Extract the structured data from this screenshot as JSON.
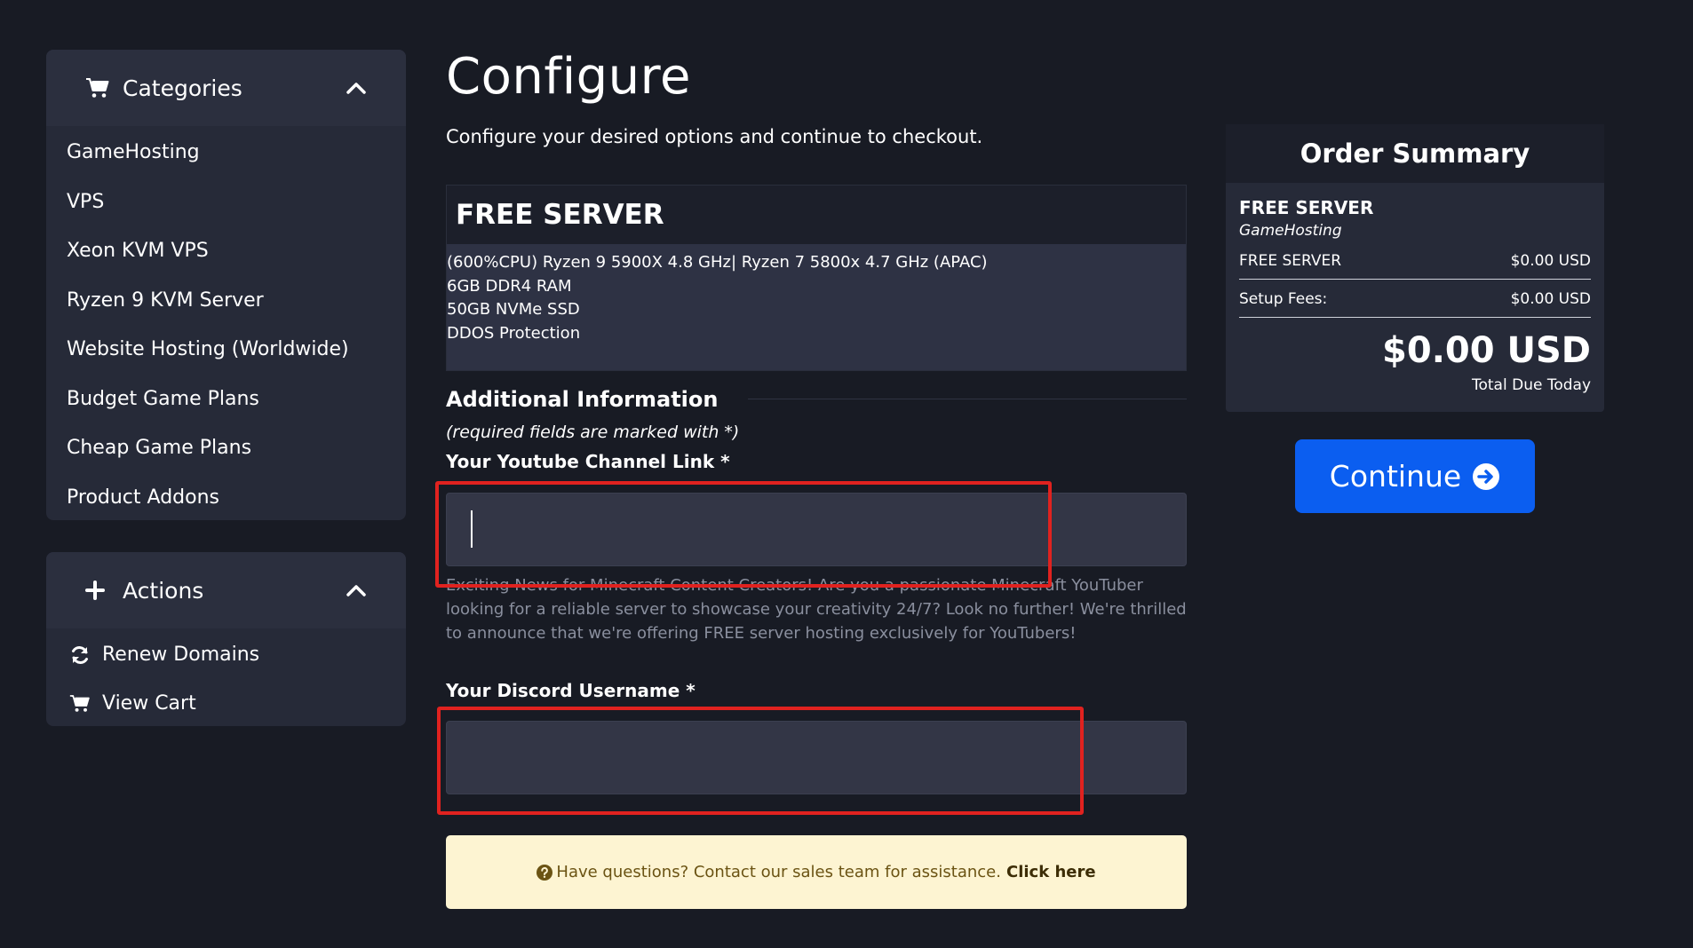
{
  "sidebar": {
    "categories": {
      "title": "Categories",
      "items": [
        {
          "label": "GameHosting"
        },
        {
          "label": "VPS"
        },
        {
          "label": "Xeon KVM VPS"
        },
        {
          "label": "Ryzen 9 KVM Server"
        },
        {
          "label": "Website Hosting (Worldwide)"
        },
        {
          "label": "Budget Game Plans"
        },
        {
          "label": "Cheap Game Plans"
        },
        {
          "label": "Product Addons"
        }
      ]
    },
    "actions": {
      "title": "Actions",
      "items": [
        {
          "label": "Renew Domains",
          "icon": "refresh-icon"
        },
        {
          "label": "View Cart",
          "icon": "cart-icon"
        }
      ]
    }
  },
  "main": {
    "title": "Configure",
    "subtitle": "Configure your desired options and continue to checkout.",
    "product": {
      "name": "FREE SERVER",
      "features": [
        "(600%CPU) Ryzen 9 5900X 4.8 GHz| Ryzen 7 5800x 4.7 GHz (APAC)",
        "6GB DDR4 RAM",
        "50GB NVMe SSD",
        "DDOS Protection"
      ]
    },
    "additional_info": {
      "title": "Additional Information",
      "required_note": "(required fields are marked with *)",
      "youtube": {
        "label": "Your Youtube Channel Link *",
        "value": "",
        "help": "Exciting News for Minecraft Content Creators! Are you a passionate Minecraft YouTuber looking for a reliable server to showcase your creativity 24/7? Look no further! We're thrilled to announce that we're offering FREE server hosting exclusively for YouTubers!"
      },
      "discord": {
        "label": "Your Discord Username *",
        "value": ""
      }
    },
    "notice": {
      "text": "Have questions? Contact our sales team for assistance.",
      "link": "Click here"
    }
  },
  "summary": {
    "title": "Order Summary",
    "product_name": "FREE SERVER",
    "product_category": "GameHosting",
    "line_label": "FREE SERVER",
    "line_price": "$0.00 USD",
    "setup_label": "Setup Fees:",
    "setup_price": "$0.00 USD",
    "total": "$0.00 USD",
    "total_label": "Total Due Today"
  },
  "continue_label": "Continue",
  "colors": {
    "background": "#181b24",
    "panel": "#262a38",
    "primary": "#0b5ef0",
    "notice_bg": "#fdf4d2",
    "highlight": "#e0221f"
  }
}
